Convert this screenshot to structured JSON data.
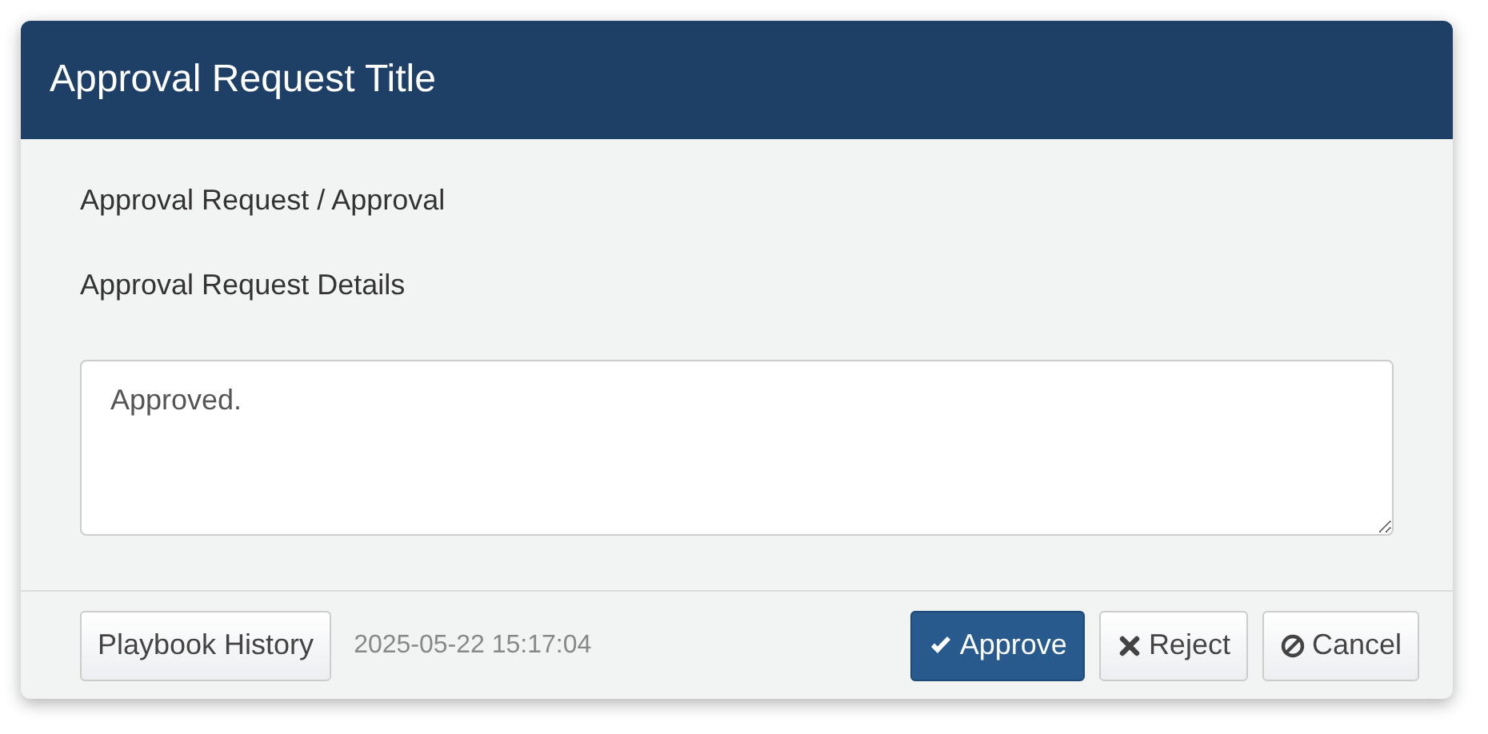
{
  "dialog": {
    "title": "Approval Request Title"
  },
  "body": {
    "breadcrumb": "Approval Request / Approval",
    "details": "Approval Request Details",
    "comment": {
      "value": "Approved."
    }
  },
  "footer": {
    "history_button": "Playbook History",
    "timestamp": "2025-05-22 15:17:04",
    "buttons": [
      {
        "kind": "approve",
        "label": "Approve"
      },
      {
        "kind": "reject",
        "label": "Reject"
      },
      {
        "kind": "cancel",
        "label": "Cancel"
      }
    ]
  }
}
